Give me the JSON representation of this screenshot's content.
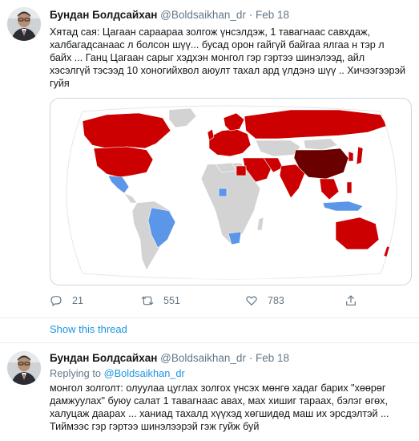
{
  "tweet1": {
    "author_name": "Бундан Болдсайхан",
    "handle": "@Boldsaikhan_dr",
    "separator": "·",
    "date": "Feb 18",
    "text_lines": [
      "Хятад сая: Цагаан сараараа золгож үнсэлдэж, 1 тавагнаас савхдаж,",
      "халбагадсанаас л болсон шүү... бусад орон гайгүй байгаа ялгаа н тэр л",
      "байх ... Ганц Цагаан сарыг хэдхэн монгол гэр гэртээ шинэлээд, айл",
      "хэсэлгүй тэсээд 10 хоногийхвол аюулт тахал ард үлдэнэ шүү .. Хичээгээрэй",
      "гуйя"
    ],
    "actions": {
      "reply_count": "21",
      "retweet_count": "551",
      "like_count": "783"
    }
  },
  "show_thread_label": "Show this thread",
  "tweet2": {
    "author_name": "Бундан Болдсайхан",
    "handle": "@Boldsaikhan_dr",
    "separator": "·",
    "date": "Feb 18",
    "replying_label": "Replying to",
    "replying_to": "@Boldsaikhan_dr",
    "text_lines": [
      "монгол золголт: олуулаа цуглах золгох үнсэх мөнгө хадаг барих \"хөөрөг",
      "дамжуулах\" буюу салат 1 тавагнаас авах, мах хишиг тараах, бэлэг өгөх,",
      "халуцаж даарах ... ханиад тахалд хүүхэд хөгшидөд маш их эрсдэлтэй ...",
      "Тиймээс гэр гэртээ шинэлээрэй гэж гуйж буй"
    ]
  },
  "colors": {
    "link": "#1b95e0",
    "muted": "#657786",
    "map_red": "#cc0000",
    "map_dark_red": "#6b0000",
    "map_blue": "#5b96e8",
    "map_grey": "#d3d3d3"
  }
}
